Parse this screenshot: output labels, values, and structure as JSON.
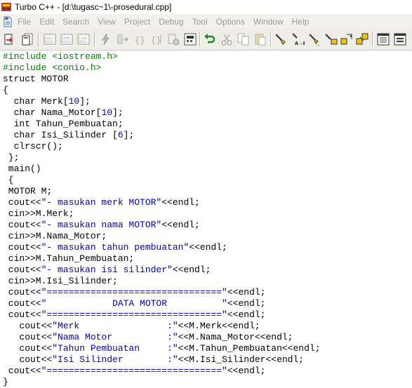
{
  "window": {
    "title": "Turbo C++ - [d:\\tugasc~1\\-prosedural.cpp]"
  },
  "menu": [
    "File",
    "Edit",
    "Search",
    "View",
    "Project",
    "Debug",
    "Tool",
    "Options",
    "Window",
    "Help"
  ],
  "toolbar": {
    "buttons": [
      "open-icon",
      "save-icon",
      "compile-file-icon",
      "make-icon",
      "build-all-icon",
      "run-icon",
      "step-over-icon",
      "trace-into-icon",
      "go-to-cursor-icon",
      "toggle-breakpoint-icon",
      "evaluate-icon",
      "watch-icon",
      "undo-icon",
      "cut-icon",
      "copy-icon",
      "paste-icon",
      "search-icon",
      "replace-icon",
      "search-again-icon",
      "find-next-icon",
      "browse-symbol-icon",
      "browse-object-icon",
      "tile-window-icon",
      "cascade-window-icon"
    ]
  },
  "editor": {
    "lines": [
      [
        {
          "t": "#include <iostream.h>",
          "c": "pp"
        }
      ],
      [
        {
          "t": "#include <conio.h>",
          "c": "pp"
        }
      ],
      [
        {
          "t": "struct MOTOR",
          "c": "plain"
        }
      ],
      [
        {
          "t": "{",
          "c": "plain"
        }
      ],
      [
        {
          "t": "  char Merk[",
          "c": "plain"
        },
        {
          "t": "10",
          "c": "num"
        },
        {
          "t": "];",
          "c": "plain"
        }
      ],
      [
        {
          "t": "  char Nama_Motor[",
          "c": "plain"
        },
        {
          "t": "10",
          "c": "num"
        },
        {
          "t": "];",
          "c": "plain"
        }
      ],
      [
        {
          "t": "  int Tahun_Pembuatan;",
          "c": "plain"
        }
      ],
      [
        {
          "t": "  char Isi_Silinder [",
          "c": "plain"
        },
        {
          "t": "6",
          "c": "num"
        },
        {
          "t": "];",
          "c": "plain"
        }
      ],
      [
        {
          "t": "  clrscr();",
          "c": "plain"
        }
      ],
      [
        {
          "t": " };",
          "c": "plain"
        }
      ],
      [
        {
          "t": " main()",
          "c": "plain"
        }
      ],
      [
        {
          "t": " {",
          "c": "plain"
        }
      ],
      [
        {
          "t": " MOTOR M;",
          "c": "plain"
        }
      ],
      [
        {
          "t": " cout<<",
          "c": "plain"
        },
        {
          "t": "\"- masukan merk MOTOR\"",
          "c": "str"
        },
        {
          "t": "<<endl;",
          "c": "plain"
        }
      ],
      [
        {
          "t": " cin>>M.Merk;",
          "c": "plain"
        }
      ],
      [
        {
          "t": " cout<<",
          "c": "plain"
        },
        {
          "t": "\"- masukan nama MOTOR\"",
          "c": "str"
        },
        {
          "t": "<<endl;",
          "c": "plain"
        }
      ],
      [
        {
          "t": " cin>>M.Nama_Motor;",
          "c": "plain"
        }
      ],
      [
        {
          "t": " cout<<",
          "c": "plain"
        },
        {
          "t": "\"- masukan tahun pembuatan\"",
          "c": "str"
        },
        {
          "t": "<<endl;",
          "c": "plain"
        }
      ],
      [
        {
          "t": " cin>>M.Tahun_Pembuatan;",
          "c": "plain"
        }
      ],
      [
        {
          "t": " cout<<",
          "c": "plain"
        },
        {
          "t": "\"- masukan isi silinder\"",
          "c": "str"
        },
        {
          "t": "<<endl;",
          "c": "plain"
        }
      ],
      [
        {
          "t": " cin>>M.Isi_Silinder;",
          "c": "plain"
        }
      ],
      [
        {
          "t": " cout<<",
          "c": "plain"
        },
        {
          "t": "\"================================\"",
          "c": "str"
        },
        {
          "t": "<<endl;",
          "c": "plain"
        }
      ],
      [
        {
          "t": " cout<<",
          "c": "plain"
        },
        {
          "t": "\"            DATA MOTOR          \"",
          "c": "str"
        },
        {
          "t": "<<endl;",
          "c": "plain"
        }
      ],
      [
        {
          "t": " cout<<",
          "c": "plain"
        },
        {
          "t": "\"================================\"",
          "c": "str"
        },
        {
          "t": "<<endl;",
          "c": "plain"
        }
      ],
      [
        {
          "t": "   cout<<",
          "c": "plain"
        },
        {
          "t": "\"Merk                :\"",
          "c": "str"
        },
        {
          "t": "<<M.Merk<<endl;",
          "c": "plain"
        }
      ],
      [
        {
          "t": "   cout<<",
          "c": "plain"
        },
        {
          "t": "\"Nama Motor          :\"",
          "c": "str"
        },
        {
          "t": "<<M.Nama_Motor<<endl;",
          "c": "plain"
        }
      ],
      [
        {
          "t": "   cout<<",
          "c": "plain"
        },
        {
          "t": "\"Tahun Pembuatan     :\"",
          "c": "str"
        },
        {
          "t": "<<M.Tahun_Pembuatan<<endl;",
          "c": "plain"
        }
      ],
      [
        {
          "t": "   cout<<",
          "c": "plain"
        },
        {
          "t": "\"Isi Silinder        :\"",
          "c": "str"
        },
        {
          "t": "<<M.Isi_Silinder<<endl;",
          "c": "plain"
        }
      ],
      [
        {
          "t": " cout<<",
          "c": "plain"
        },
        {
          "t": "\"================================\"",
          "c": "str"
        },
        {
          "t": "<<endl;",
          "c": "plain"
        }
      ],
      [
        {
          "t": "}",
          "c": "plain"
        }
      ]
    ]
  }
}
